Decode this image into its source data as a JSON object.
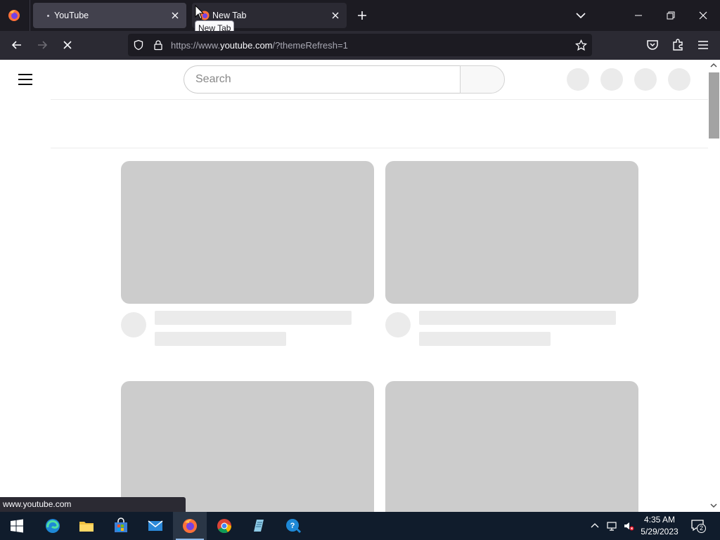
{
  "browser": {
    "tabs": [
      {
        "title": "YouTube",
        "state": "active-loading"
      },
      {
        "title": "New Tab",
        "state": "background"
      }
    ],
    "tooltip": "New Tab",
    "url": {
      "prefix": "https://www.",
      "host": "youtube.com",
      "path": "/?themeRefresh=1"
    },
    "status_text": "www.youtube.com"
  },
  "page": {
    "search": {
      "placeholder": "Search",
      "value": ""
    },
    "loading": true
  },
  "taskbar": {
    "apps": [
      "start-icon",
      "edge-icon",
      "file-explorer-icon",
      "store-icon",
      "mail-icon",
      "firefox-icon",
      "chrome-icon",
      "notepad-icon",
      "help-icon"
    ],
    "active_app": "firefox-icon",
    "time": "4:35 AM",
    "date": "5/29/2023",
    "notification_count": "2"
  },
  "colors": {
    "tabstrip": "#1c1b22",
    "toolbar": "#2b2a33",
    "taskbar": "#101c2c",
    "placeholder_thumb": "#cccccc",
    "placeholder_line": "#ebebeb"
  }
}
